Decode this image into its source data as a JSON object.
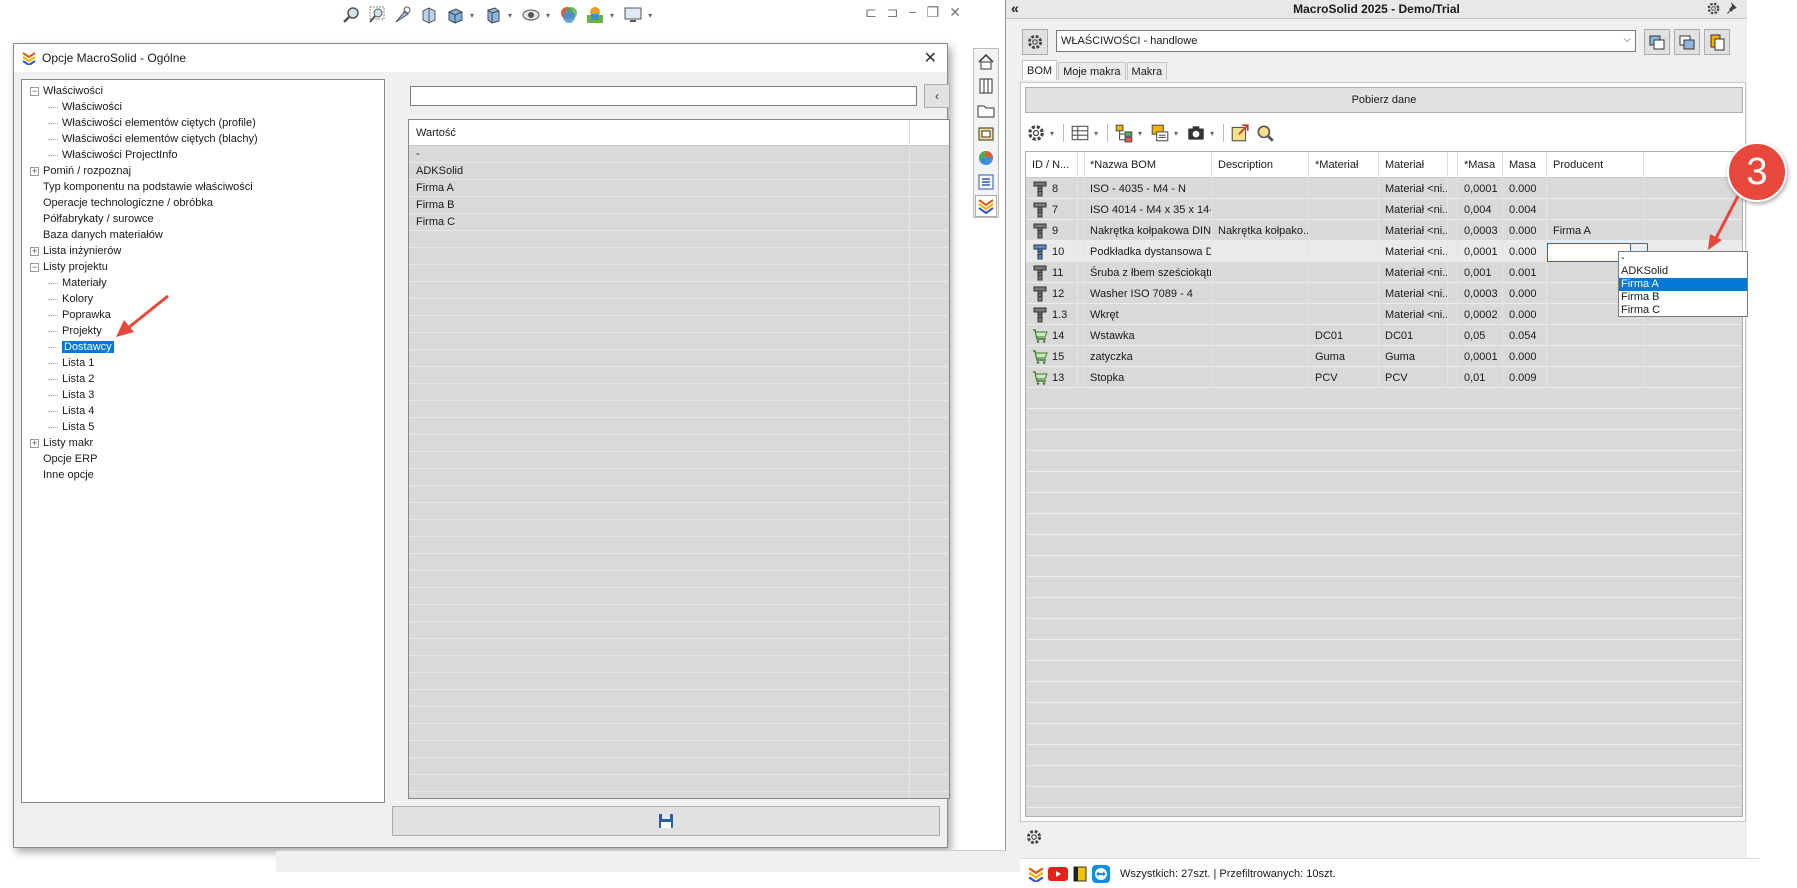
{
  "dialog": {
    "title": "Opcje MacroSolid - Ogólne",
    "tree": [
      {
        "label": "Właściwości",
        "level": 0,
        "expander": "−"
      },
      {
        "label": "Właściwości",
        "level": 1
      },
      {
        "label": "Właściwości elementów ciętych (profile)",
        "level": 1
      },
      {
        "label": "Właściwości elementów ciętych (blachy)",
        "level": 1
      },
      {
        "label": "Właściwości ProjectInfo",
        "level": 1
      },
      {
        "label": "Pomiń / rozpoznaj",
        "level": 0,
        "expander": "+"
      },
      {
        "label": "Typ komponentu na podstawie właściwości",
        "level": 0
      },
      {
        "label": "Operacje technologiczne / obróbka",
        "level": 0
      },
      {
        "label": "Półfabrykaty / surowce",
        "level": 0
      },
      {
        "label": "Baza danych materiałów",
        "level": 0
      },
      {
        "label": "Lista inżynierów",
        "level": 0,
        "expander": "+"
      },
      {
        "label": "Listy projektu",
        "level": 0,
        "expander": "−"
      },
      {
        "label": "Materiały",
        "level": 1
      },
      {
        "label": "Kolory",
        "level": 1
      },
      {
        "label": "Poprawka",
        "level": 1
      },
      {
        "label": "Projekty",
        "level": 1
      },
      {
        "label": "Dostawcy",
        "level": 1,
        "selected": true
      },
      {
        "label": "Lista 1",
        "level": 1
      },
      {
        "label": "Lista 2",
        "level": 1
      },
      {
        "label": "Lista 3",
        "level": 1
      },
      {
        "label": "Lista 4",
        "level": 1
      },
      {
        "label": "Lista 5",
        "level": 1
      },
      {
        "label": "Listy makr",
        "level": 0,
        "expander": "+"
      },
      {
        "label": "Opcje ERP",
        "level": 0
      },
      {
        "label": "Inne opcje",
        "level": 0
      }
    ],
    "filter_value": "",
    "filter_button": "‹",
    "values_header": "Wartość",
    "values": [
      "-",
      "ADKSolid",
      "Firma A",
      "Firma B",
      "Firma C"
    ],
    "empty_rows": 34
  },
  "panel": {
    "title": "MacroSolid 2025 - Demo/Trial",
    "collapse": "«",
    "property_set": "WŁAŚCIWOŚCI - handlowe",
    "tabs": [
      "BOM",
      "Moje makra",
      "Makra"
    ],
    "active_tab": "BOM",
    "fetch_button": "Pobierz dane",
    "columns": [
      "ID / N...",
      "",
      "*Nazwa BOM",
      "Description",
      "*Materiał",
      "Materiał",
      "",
      "*Masa",
      "Masa",
      "Producent"
    ],
    "rows": [
      {
        "icon": "bolt",
        "id": "8",
        "name": "ISO - 4035 - M4 - N",
        "desc": "",
        "mat1": "",
        "mat2": "Materiał <ni...",
        "mass1": "0,0001",
        "mass2": "0.000",
        "producer": ""
      },
      {
        "icon": "bolt",
        "id": "7",
        "name": "ISO 4014 - M4 x 35 x 14-N",
        "desc": "",
        "mat1": "",
        "mat2": "Materiał <ni...",
        "mass1": "0,004",
        "mass2": "0.004",
        "producer": ""
      },
      {
        "icon": "bolt",
        "id": "9",
        "name": "Nakrętka kołpakowa DIN...",
        "desc": "Nakrętka kołpako...",
        "mat1": "",
        "mat2": "Materiał <ni...",
        "mass1": "0,0003",
        "mass2": "0.000",
        "producer": "Firma A"
      },
      {
        "icon": "bolt-blue",
        "id": "10",
        "name": "Podkładka dystansowa D...",
        "desc": "",
        "mat1": "",
        "mat2": "Materiał <ni...",
        "mass1": "0,0001",
        "mass2": "0.000",
        "producer": "",
        "selected": true
      },
      {
        "icon": "bolt",
        "id": "11",
        "name": "Śruba z łbem sześciokątn...",
        "desc": "",
        "mat1": "",
        "mat2": "Materiał <ni...",
        "mass1": "0,001",
        "mass2": "0.001",
        "producer": ""
      },
      {
        "icon": "bolt",
        "id": "12",
        "name": "Washer ISO 7089 - 4",
        "desc": "",
        "mat1": "",
        "mat2": "Materiał <ni...",
        "mass1": "0,0003",
        "mass2": "0.000",
        "producer": ""
      },
      {
        "icon": "bolt",
        "id": "1.3",
        "name": "Wkręt",
        "desc": "",
        "mat1": "",
        "mat2": "Materiał <ni...",
        "mass1": "0,0002",
        "mass2": "0.000",
        "producer": ""
      },
      {
        "icon": "cart",
        "id": "14",
        "name": "Wstawka",
        "desc": "",
        "mat1": "DC01",
        "mat2": "DC01",
        "mass1": "0,05",
        "mass2": "0.054",
        "producer": ""
      },
      {
        "icon": "cart",
        "id": "15",
        "name": "zatyczka",
        "desc": "",
        "mat1": "Guma",
        "mat2": "Guma",
        "mass1": "0,0001",
        "mass2": "0.000",
        "producer": ""
      },
      {
        "icon": "cart",
        "id": "13",
        "name": "Stopka",
        "desc": "",
        "mat1": "PCV",
        "mat2": "PCV",
        "mass1": "0,01",
        "mass2": "0.009",
        "producer": ""
      }
    ],
    "dropdown_options": [
      "-",
      "ADKSolid",
      "Firma A",
      "Firma B",
      "Firma C"
    ],
    "dropdown_highlight": "Firma A",
    "status": "Wszystkich: 27szt. | Przefiltrowanych: 10szt."
  },
  "annotation": {
    "badge": "3"
  },
  "colors": {
    "selection": "#0078d7",
    "badge": "#e8473c",
    "arrow": "#e8473c"
  }
}
